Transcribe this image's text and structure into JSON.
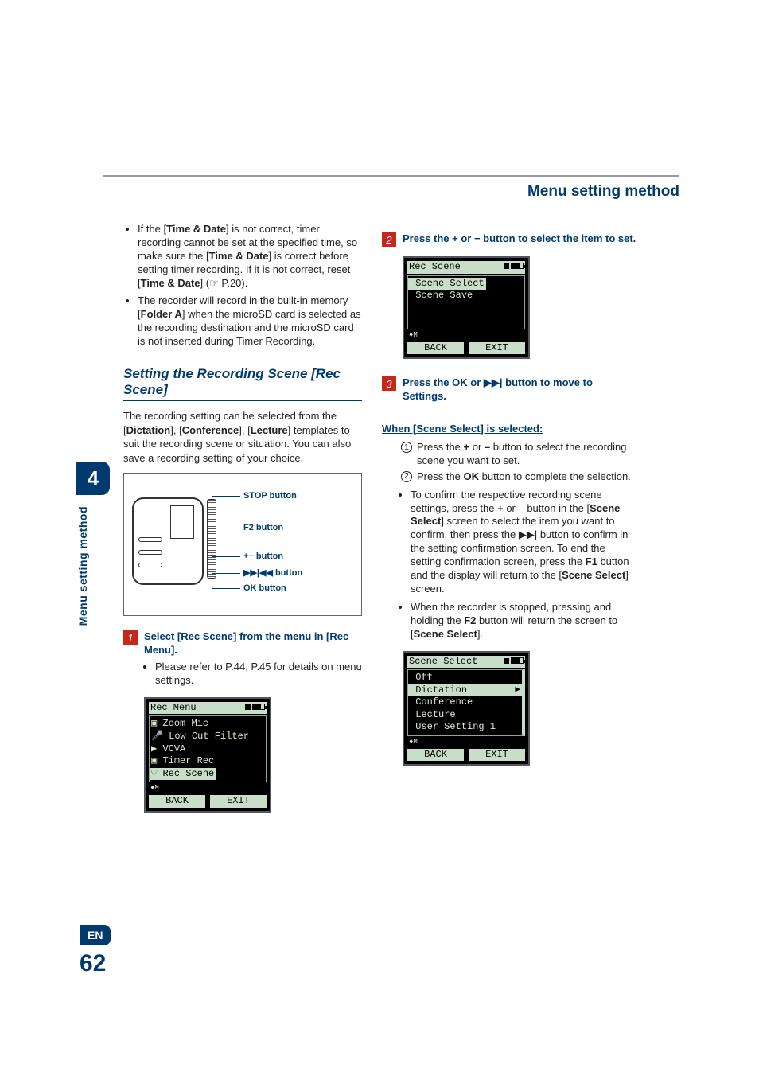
{
  "page_title": "Menu setting method",
  "sidebar": {
    "chapter": "4",
    "vtext": "Menu setting method",
    "lang": "EN",
    "pagenum": "62"
  },
  "left": {
    "note1a": "If the [",
    "note1b": "Time & Date",
    "note1c": "] is not correct, timer recording cannot be set at the specified time, so make sure the [",
    "note1d": "Time & Date",
    "note1e": "] is correct before setting timer recording. If it is not correct, reset [",
    "note1f": "Time & Date",
    "note1g": "] (☞ P.20).",
    "note2a": "The recorder will record in the built-in memory [",
    "note2b": "Folder A",
    "note2c": "] when the microSD card is selected as the recording destination and the microSD card is not inserted during Timer Recording.",
    "section_title": "Setting the Recording Scene [Rec Scene]",
    "intro_a": "The recording setting can be selected from the [",
    "intro_b": "Dictation",
    "intro_c": "], [",
    "intro_d": "Conference",
    "intro_e": "], [",
    "intro_f": "Lecture",
    "intro_g": "] templates to suit the recording scene or situation. You can also save a recording setting of your choice.",
    "callouts": {
      "c1": "STOP button",
      "c2": "F2 button",
      "c3": "+− button",
      "c4": "▶▶|◀◀ button",
      "c5": "OK button"
    },
    "step1": {
      "num": "1",
      "text_a": "Select [",
      "text_b": "Rec Scene",
      "text_c": "] from the menu in [",
      "text_d": "Rec Menu",
      "text_e": "]."
    },
    "step1_sub": "Please refer to P.44, P.45 for details on menu settings.",
    "lcd1": {
      "title": "Rec Menu",
      "rows": [
        "Zoom Mic",
        "Low Cut Filter",
        "VCVA",
        "Timer Rec"
      ],
      "hl": "Rec Scene",
      "back": "BACK",
      "exit": "EXIT"
    }
  },
  "right": {
    "step2": {
      "num": "2",
      "text": "Press the + or − button to select the item to set."
    },
    "lcd2": {
      "title": "Rec Scene",
      "hl": "Scene Select",
      "rows": [
        "Scene Save"
      ],
      "back": "BACK",
      "exit": "EXIT"
    },
    "step3": {
      "num": "3",
      "text_a": "Press the ",
      "text_b": "OK",
      "text_c": " or ▶▶| button to move to Settings."
    },
    "when_title_a": "When [",
    "when_title_b": "Scene Select",
    "when_title_c": "] is selected:",
    "n1_a": "Press the ",
    "n1_b": "+",
    "n1_c": " or ",
    "n1_d": "–",
    "n1_e": " button to select the recording scene you want to set.",
    "n2_a": "Press the ",
    "n2_b": "OK",
    "n2_c": " button to complete the selection.",
    "b1_a": "To confirm the respective recording scene settings, press the + or – button in the [",
    "b1_b": "Scene Select",
    "b1_c": "] screen to select the item you want to confirm, then press the ▶▶| button to confirm in the setting confirmation screen. To end the setting confirmation screen, press the ",
    "b1_d": "F1",
    "b1_e": " button and the display will return to the [",
    "b1_f": "Scene Select",
    "b1_g": "] screen.",
    "b2_a": "When the recorder is stopped, pressing and holding the ",
    "b2_b": "F2",
    "b2_c": " button will return the screen to [",
    "b2_d": "Scene Select",
    "b2_e": "].",
    "lcd3": {
      "title": "Scene Select",
      "rows_before": [
        "Off"
      ],
      "hl": "Dictation",
      "rows_after": [
        "Conference",
        "Lecture",
        "User Setting 1"
      ],
      "back": "BACK",
      "exit": "EXIT"
    }
  }
}
